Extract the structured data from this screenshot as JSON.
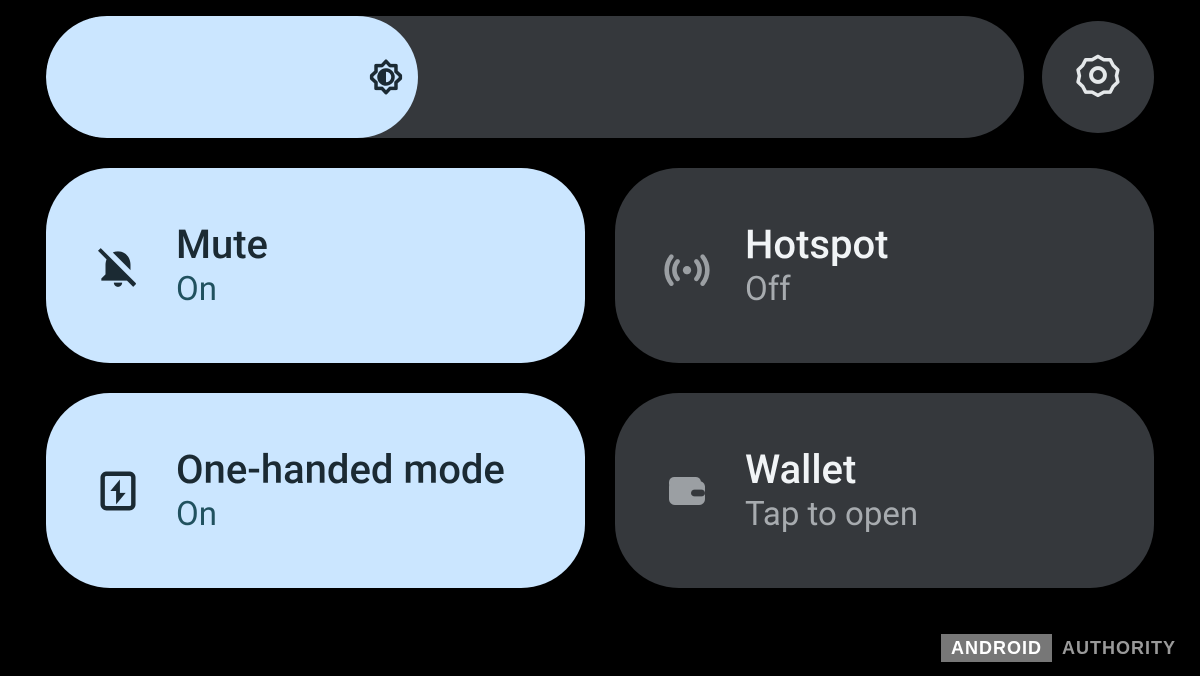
{
  "brightness": {
    "percent": 38
  },
  "tiles": [
    {
      "title": "Mute",
      "status": "On",
      "active": true,
      "icon": "bell-off-icon"
    },
    {
      "title": "Hotspot",
      "status": "Off",
      "active": false,
      "icon": "hotspot-icon"
    },
    {
      "title": "One-handed mode",
      "status": "On",
      "active": true,
      "icon": "one-handed-icon"
    },
    {
      "title": "Wallet",
      "status": "Tap to open",
      "active": false,
      "icon": "wallet-icon"
    }
  ],
  "watermark": {
    "left": "ANDROID",
    "right": "AUTHORITY"
  }
}
